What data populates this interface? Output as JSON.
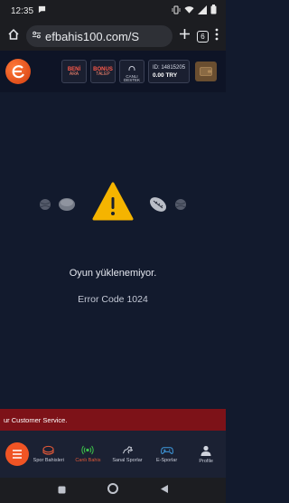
{
  "status_bar": {
    "time": "12:35",
    "battery": "▮"
  },
  "browser": {
    "url": "efbahis100.com/S",
    "tab_count": "6"
  },
  "header": {
    "btn_1_line1": "BENİ",
    "btn_1_line2": "ARA",
    "btn_2_line1": "BONUS",
    "btn_2_line2": "TALEP",
    "btn_3_line1": "CANLI",
    "btn_3_line2": "DESTEK",
    "account_id": "ID: 14815205",
    "balance": "0.00 TRY"
  },
  "error": {
    "message": "Oyun yüklenemiyor.",
    "code": "Error Code 1024"
  },
  "marquee": {
    "text": "ur Customer Service."
  },
  "bottom_nav": {
    "items": [
      {
        "label": "Spor Bahisleri"
      },
      {
        "label": "Canlı Bahis"
      },
      {
        "label": "Sanal Sporlar"
      },
      {
        "label": "E-Sporlar"
      },
      {
        "label": "Profile"
      }
    ]
  },
  "colors": {
    "accent": "#f05424",
    "warning": "#f5b400",
    "marquee_bg": "#7d1218",
    "bg": "#121a2d"
  }
}
